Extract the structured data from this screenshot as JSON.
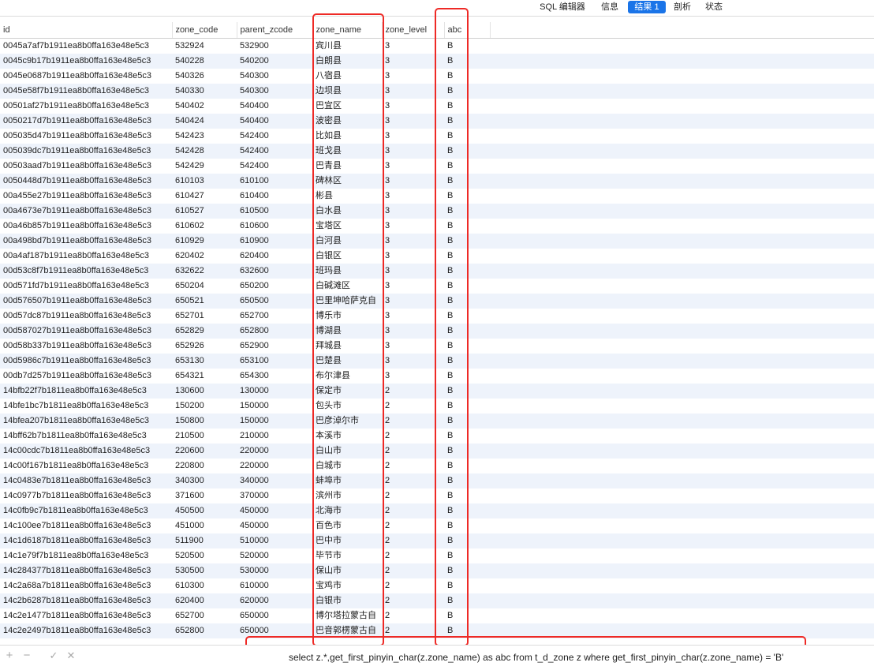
{
  "tabs": [
    {
      "label": "SQL 编辑器",
      "active": false
    },
    {
      "label": "信息",
      "active": false
    },
    {
      "label": "结果 1",
      "active": true
    },
    {
      "label": "剖析",
      "active": false
    },
    {
      "label": "状态",
      "active": false
    }
  ],
  "columns": [
    "id",
    "zone_code",
    "parent_zcode",
    "zone_name",
    "zone_level",
    "abc"
  ],
  "rows": [
    [
      "0045a7af7b1911ea8b0ffa163e48e5c3",
      "532924",
      "532900",
      "宾川县",
      "3",
      "B"
    ],
    [
      "0045c9b17b1911ea8b0ffa163e48e5c3",
      "540228",
      "540200",
      "白朗县",
      "3",
      "B"
    ],
    [
      "0045e0687b1911ea8b0ffa163e48e5c3",
      "540326",
      "540300",
      "八宿县",
      "3",
      "B"
    ],
    [
      "0045e58f7b1911ea8b0ffa163e48e5c3",
      "540330",
      "540300",
      "边坝县",
      "3",
      "B"
    ],
    [
      "00501af27b1911ea8b0ffa163e48e5c3",
      "540402",
      "540400",
      "巴宜区",
      "3",
      "B"
    ],
    [
      "0050217d7b1911ea8b0ffa163e48e5c3",
      "540424",
      "540400",
      "波密县",
      "3",
      "B"
    ],
    [
      "005035d47b1911ea8b0ffa163e48e5c3",
      "542423",
      "542400",
      "比如县",
      "3",
      "B"
    ],
    [
      "005039dc7b1911ea8b0ffa163e48e5c3",
      "542428",
      "542400",
      "班戈县",
      "3",
      "B"
    ],
    [
      "00503aad7b1911ea8b0ffa163e48e5c3",
      "542429",
      "542400",
      "巴青县",
      "3",
      "B"
    ],
    [
      "0050448d7b1911ea8b0ffa163e48e5c3",
      "610103",
      "610100",
      "碑林区",
      "3",
      "B"
    ],
    [
      "00a455e27b1911ea8b0ffa163e48e5c3",
      "610427",
      "610400",
      "彬县",
      "3",
      "B"
    ],
    [
      "00a4673e7b1911ea8b0ffa163e48e5c3",
      "610527",
      "610500",
      "白水县",
      "3",
      "B"
    ],
    [
      "00a46b857b1911ea8b0ffa163e48e5c3",
      "610602",
      "610600",
      "宝塔区",
      "3",
      "B"
    ],
    [
      "00a498bd7b1911ea8b0ffa163e48e5c3",
      "610929",
      "610900",
      "白河县",
      "3",
      "B"
    ],
    [
      "00a4af187b1911ea8b0ffa163e48e5c3",
      "620402",
      "620400",
      "白银区",
      "3",
      "B"
    ],
    [
      "00d53c8f7b1911ea8b0ffa163e48e5c3",
      "632622",
      "632600",
      "班玛县",
      "3",
      "B"
    ],
    [
      "00d571fd7b1911ea8b0ffa163e48e5c3",
      "650204",
      "650200",
      "白碱滩区",
      "3",
      "B"
    ],
    [
      "00d576507b1911ea8b0ffa163e48e5c3",
      "650521",
      "650500",
      "巴里坤哈萨克自",
      "3",
      "B"
    ],
    [
      "00d57dc87b1911ea8b0ffa163e48e5c3",
      "652701",
      "652700",
      "博乐市",
      "3",
      "B"
    ],
    [
      "00d587027b1911ea8b0ffa163e48e5c3",
      "652829",
      "652800",
      "博湖县",
      "3",
      "B"
    ],
    [
      "00d58b337b1911ea8b0ffa163e48e5c3",
      "652926",
      "652900",
      "拜城县",
      "3",
      "B"
    ],
    [
      "00d5986c7b1911ea8b0ffa163e48e5c3",
      "653130",
      "653100",
      "巴楚县",
      "3",
      "B"
    ],
    [
      "00db7d257b1911ea8b0ffa163e48e5c3",
      "654321",
      "654300",
      "布尔津县",
      "3",
      "B"
    ],
    [
      "14bfb22f7b1811ea8b0ffa163e48e5c3",
      "130600",
      "130000",
      "保定市",
      "2",
      "B"
    ],
    [
      "14bfe1bc7b1811ea8b0ffa163e48e5c3",
      "150200",
      "150000",
      "包头市",
      "2",
      "B"
    ],
    [
      "14bfea207b1811ea8b0ffa163e48e5c3",
      "150800",
      "150000",
      "巴彦淖尔市",
      "2",
      "B"
    ],
    [
      "14bff62b7b1811ea8b0ffa163e48e5c3",
      "210500",
      "210000",
      "本溪市",
      "2",
      "B"
    ],
    [
      "14c00cdc7b1811ea8b0ffa163e48e5c3",
      "220600",
      "220000",
      "白山市",
      "2",
      "B"
    ],
    [
      "14c00f167b1811ea8b0ffa163e48e5c3",
      "220800",
      "220000",
      "白城市",
      "2",
      "B"
    ],
    [
      "14c0483e7b1811ea8b0ffa163e48e5c3",
      "340300",
      "340000",
      "蚌埠市",
      "2",
      "B"
    ],
    [
      "14c0977b7b1811ea8b0ffa163e48e5c3",
      "371600",
      "370000",
      "滨州市",
      "2",
      "B"
    ],
    [
      "14c0fb9c7b1811ea8b0ffa163e48e5c3",
      "450500",
      "450000",
      "北海市",
      "2",
      "B"
    ],
    [
      "14c100ee7b1811ea8b0ffa163e48e5c3",
      "451000",
      "450000",
      "百色市",
      "2",
      "B"
    ],
    [
      "14c1d6187b1811ea8b0ffa163e48e5c3",
      "511900",
      "510000",
      "巴中市",
      "2",
      "B"
    ],
    [
      "14c1e79f7b1811ea8b0ffa163e48e5c3",
      "520500",
      "520000",
      "毕节市",
      "2",
      "B"
    ],
    [
      "14c284377b1811ea8b0ffa163e48e5c3",
      "530500",
      "530000",
      "保山市",
      "2",
      "B"
    ],
    [
      "14c2a68a7b1811ea8b0ffa163e48e5c3",
      "610300",
      "610000",
      "宝鸡市",
      "2",
      "B"
    ],
    [
      "14c2b6287b1811ea8b0ffa163e48e5c3",
      "620400",
      "620000",
      "白银市",
      "2",
      "B"
    ],
    [
      "14c2e1477b1811ea8b0ffa163e48e5c3",
      "652700",
      "650000",
      "博尔塔拉蒙古自",
      "2",
      "B"
    ],
    [
      "14c2e2497b1811ea8b0ffa163e48e5c3",
      "652800",
      "650000",
      "巴音郭楞蒙古自",
      "2",
      "B"
    ]
  ],
  "toolbar": {
    "add_icon": "+",
    "remove_icon": "−",
    "apply_icon": "✓",
    "discard_icon": "✕"
  },
  "sql": "select z.*,get_first_pinyin_char(z.zone_name) as abc from t_d_zone z where get_first_pinyin_char(z.zone_name) = 'B'",
  "colors": {
    "accent": "#1a74e8",
    "highlight": "#ee2a26",
    "row_alt": "#eef3fb"
  }
}
